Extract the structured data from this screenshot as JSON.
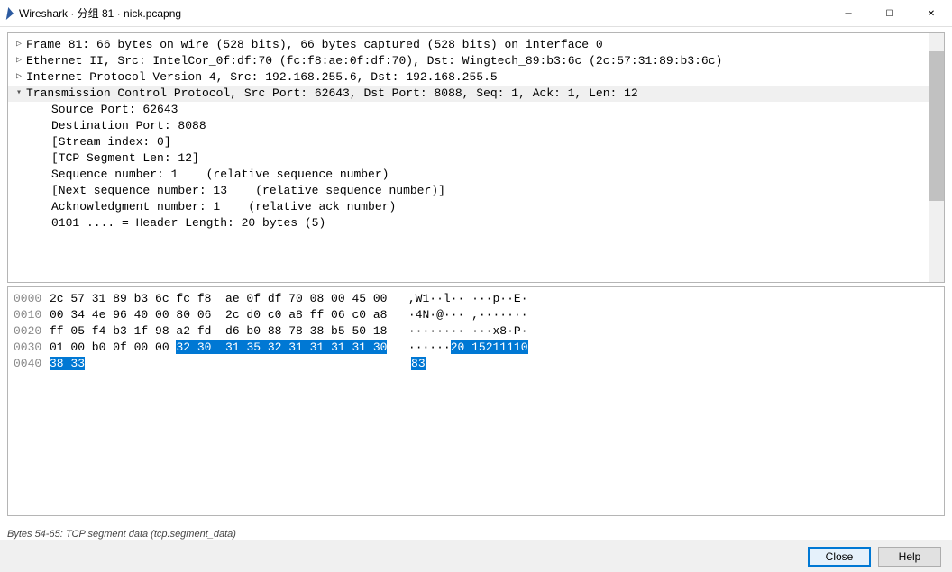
{
  "window": {
    "title": "Wireshark · 分组 81 · nick.pcapng"
  },
  "protocol_tree": {
    "frame": "Frame 81: 66 bytes on wire (528 bits), 66 bytes captured (528 bits) on interface 0",
    "eth": "Ethernet II, Src: IntelCor_0f:df:70 (fc:f8:ae:0f:df:70), Dst: Wingtech_89:b3:6c (2c:57:31:89:b3:6c)",
    "ip": "Internet Protocol Version 4, Src: 192.168.255.6, Dst: 192.168.255.5",
    "tcp": "Transmission Control Protocol, Src Port: 62643, Dst Port: 8088, Seq: 1, Ack: 1, Len: 12",
    "tcp_details": {
      "src_port": "Source Port: 62643",
      "dst_port": "Destination Port: 8088",
      "stream": "[Stream index: 0]",
      "seglen": "[TCP Segment Len: 12]",
      "seq": "Sequence number: 1    (relative sequence number)",
      "nextseq": "[Next sequence number: 13    (relative sequence number)]",
      "ack": "Acknowledgment number: 1    (relative ack number)",
      "hdrlen": "0101 .... = Header Length: 20 bytes (5)"
    }
  },
  "hex_dump": {
    "rows": [
      {
        "offset": "0000",
        "hex_a": "2c 57 31 89 b3 6c fc f8  ae 0f df 70 08 00 45 00",
        "ascii": "   ,W1··l·· ···p··E·"
      },
      {
        "offset": "0010",
        "hex_a": "00 34 4e 96 40 00 80 06  2c d0 c0 a8 ff 06 c0 a8",
        "ascii": "   ·4N·@··· ,·······"
      },
      {
        "offset": "0020",
        "hex_a": "ff 05 f4 b3 1f 98 a2 fd  d6 b0 88 78 38 b5 50 18",
        "ascii": "   ········ ···x8·P·"
      },
      {
        "offset": "0030",
        "hex_pre": "01 00 b0 0f 00 00 ",
        "hex_sel": "32 30  31 35 32 31 31 31 31 30",
        "ascii_pre": "   ······",
        "ascii_sel": "20 15211110"
      },
      {
        "offset": "0040",
        "hex_sel2": "38 33",
        "ascii_sel2": "83"
      }
    ]
  },
  "status": "Bytes 54-65: TCP segment data (tcp.segment_data)",
  "buttons": {
    "close": "Close",
    "help": "Help"
  }
}
